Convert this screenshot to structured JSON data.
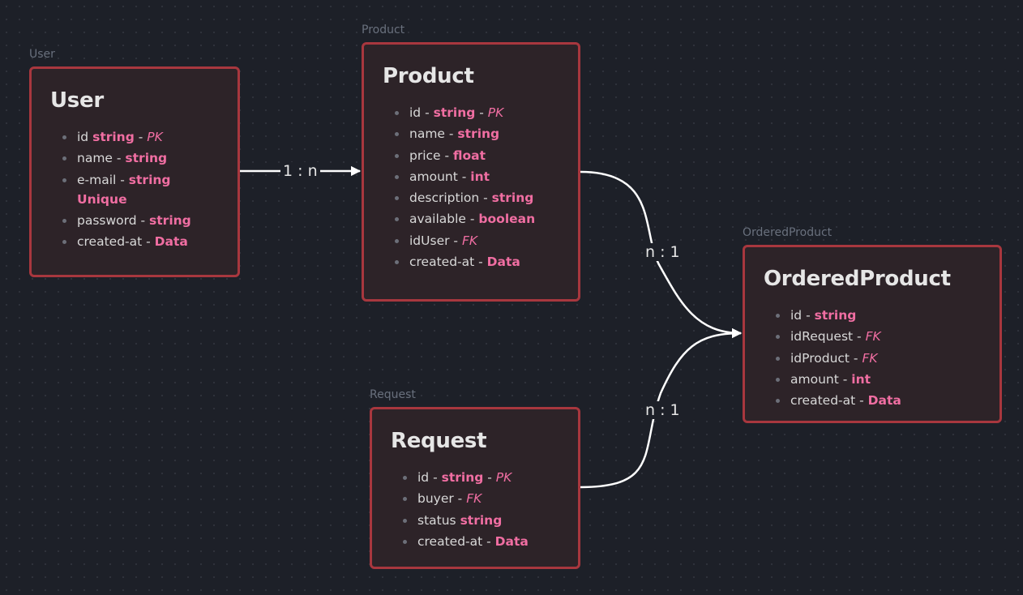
{
  "diagram": {
    "colors": {
      "background": "#1d2028",
      "node_fill": "#2d2328",
      "node_border": "#a8373e",
      "title": "#e6e6e6",
      "accent": "#f06ea2",
      "edge": "#ffffff"
    },
    "nodes": [
      {
        "id": "user",
        "label": "User",
        "title": "User",
        "fields": [
          {
            "name": "id",
            "sep": " ",
            "type": "string",
            "key": "PK"
          },
          {
            "name": "name",
            "sep": " - ",
            "type": "string"
          },
          {
            "name": "e-mail",
            "sep": " - ",
            "type": "string",
            "cont": "Unique"
          },
          {
            "name": "password",
            "sep": " - ",
            "type": "string"
          },
          {
            "name": "created-at",
            "sep": " - ",
            "type": "Data"
          }
        ]
      },
      {
        "id": "product",
        "label": "Product",
        "title": "Product",
        "fields": [
          {
            "name": "id",
            "sep": " - ",
            "type": "string",
            "key": "PK"
          },
          {
            "name": "name",
            "sep": " - ",
            "type": "string"
          },
          {
            "name": "price",
            "sep": " - ",
            "type": "float"
          },
          {
            "name": "amount",
            "sep": " - ",
            "type": "int"
          },
          {
            "name": "description",
            "sep": " - ",
            "type": "string"
          },
          {
            "name": "available",
            "sep": " - ",
            "type": "boolean"
          },
          {
            "name": "idUser",
            "sep": " - ",
            "key": "FK"
          },
          {
            "name": "created-at",
            "sep": " - ",
            "type": "Data"
          }
        ]
      },
      {
        "id": "ordered-product",
        "label": "OrderedProduct",
        "title": "OrderedProduct",
        "fields": [
          {
            "name": "id",
            "sep": " - ",
            "type": "string"
          },
          {
            "name": "idRequest",
            "sep": " - ",
            "key": "FK"
          },
          {
            "name": "idProduct",
            "sep": " - ",
            "key": "FK"
          },
          {
            "name": "amount",
            "sep": " - ",
            "type": "int"
          },
          {
            "name": "created-at",
            "sep": " - ",
            "type": "Data"
          }
        ]
      },
      {
        "id": "request",
        "label": "Request",
        "title": "Request",
        "fields": [
          {
            "name": "id",
            "sep": " - ",
            "type": "string",
            "key": "PK"
          },
          {
            "name": "buyer",
            "sep": " - ",
            "key": "FK"
          },
          {
            "name": "status",
            "sep": " ",
            "type": "string"
          },
          {
            "name": "created-at",
            "sep": " - ",
            "type": "Data"
          }
        ]
      }
    ],
    "edges": [
      {
        "from": "user",
        "to": "product",
        "label": "1 : n"
      },
      {
        "from": "product",
        "to": "ordered-product",
        "label": "n : 1"
      },
      {
        "from": "request",
        "to": "ordered-product",
        "label": "n : 1"
      }
    ]
  }
}
